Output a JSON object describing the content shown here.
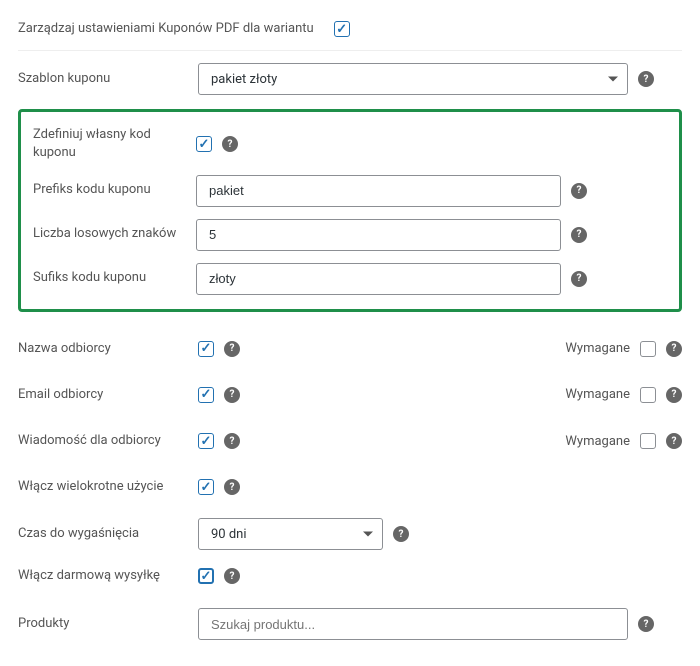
{
  "topRow": {
    "label": "Zarządzaj ustawieniami Kuponów PDF dla wariantu"
  },
  "template": {
    "label": "Szablon kuponu",
    "value": "pakiet złoty"
  },
  "codeBox": {
    "defineLabel": "Zdefiniuj własny kod kuponu",
    "prefixLabel": "Prefiks kodu kuponu",
    "prefixValue": "pakiet",
    "randomLabel": "Liczba losowych znaków",
    "randomValue": "5",
    "suffixLabel": "Sufiks kodu kuponu",
    "suffixValue": "złoty"
  },
  "recipientName": {
    "label": "Nazwa odbiorcy",
    "requiredLabel": "Wymagane"
  },
  "recipientEmail": {
    "label": "Email odbiorcy",
    "requiredLabel": "Wymagane"
  },
  "recipientMessage": {
    "label": "Wiadomość dla odbiorcy",
    "requiredLabel": "Wymagane"
  },
  "multiUse": {
    "label": "Włącz wielokrotne użycie"
  },
  "expiry": {
    "label": "Czas do wygaśnięcia",
    "value": "90 dni"
  },
  "freeShipping": {
    "label": "Włącz darmową wysyłkę"
  },
  "products": {
    "label": "Produkty",
    "placeholder": "Szukaj produktu..."
  }
}
